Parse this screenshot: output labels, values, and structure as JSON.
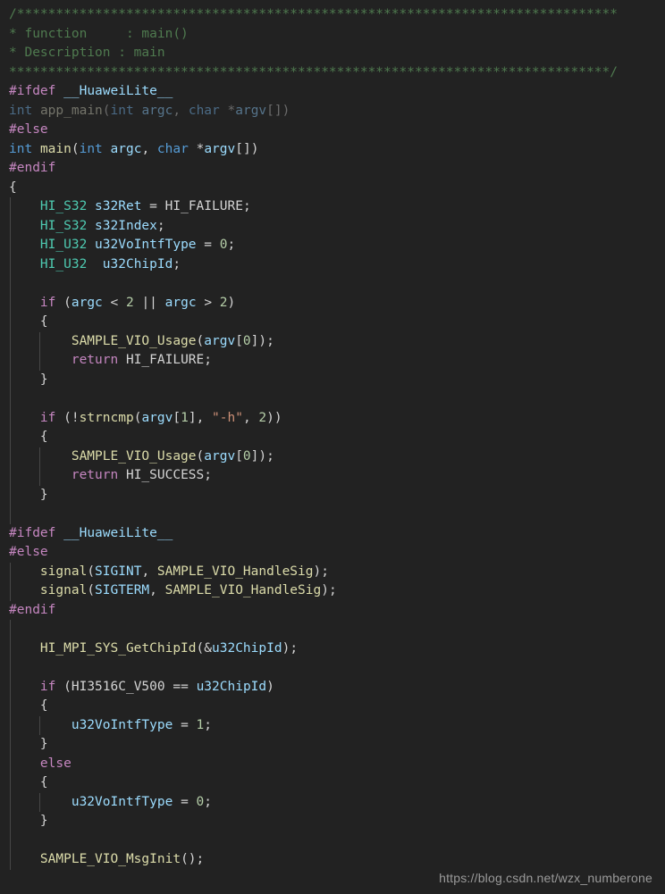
{
  "editor": {
    "background": "#222222",
    "language": "c",
    "font_size_px": 14.5,
    "line_height_px": 21.5
  },
  "theme": {
    "comment": "#4f7a4f",
    "preprocessor": "#c586c0",
    "keyword": "#569cd6",
    "type": "#4ec9b0",
    "function": "#dcdcaa",
    "variable": "#9cdcfe",
    "number": "#b5cea8",
    "string": "#ce9178",
    "default_text": "#d4d4d4",
    "indent_guide": "#474747"
  },
  "watermark": {
    "text": "https://blog.csdn.net/wzx_numberone"
  },
  "code": {
    "lines": [
      {
        "n": 1,
        "text": "/*****************************************************************************"
      },
      {
        "n": 2,
        "text": "* function     : main()"
      },
      {
        "n": 3,
        "text": "* Description : main"
      },
      {
        "n": 4,
        "text": "*****************************************************************************/"
      },
      {
        "n": 5,
        "text": "#ifdef __HuaweiLite__"
      },
      {
        "n": 6,
        "text": "int app_main(int argc, char *argv[])"
      },
      {
        "n": 7,
        "text": "#else"
      },
      {
        "n": 8,
        "text": "int main(int argc, char *argv[])"
      },
      {
        "n": 9,
        "text": "#endif"
      },
      {
        "n": 10,
        "text": "{"
      },
      {
        "n": 11,
        "text": "    HI_S32 s32Ret = HI_FAILURE;"
      },
      {
        "n": 12,
        "text": "    HI_S32 s32Index;"
      },
      {
        "n": 13,
        "text": "    HI_U32 u32VoIntfType = 0;"
      },
      {
        "n": 14,
        "text": "    HI_U32  u32ChipId;"
      },
      {
        "n": 15,
        "text": ""
      },
      {
        "n": 16,
        "text": "    if (argc < 2 || argc > 2)"
      },
      {
        "n": 17,
        "text": "    {"
      },
      {
        "n": 18,
        "text": "        SAMPLE_VIO_Usage(argv[0]);"
      },
      {
        "n": 19,
        "text": "        return HI_FAILURE;"
      },
      {
        "n": 20,
        "text": "    }"
      },
      {
        "n": 21,
        "text": ""
      },
      {
        "n": 22,
        "text": "    if (!strncmp(argv[1], \"-h\", 2))"
      },
      {
        "n": 23,
        "text": "    {"
      },
      {
        "n": 24,
        "text": "        SAMPLE_VIO_Usage(argv[0]);"
      },
      {
        "n": 25,
        "text": "        return HI_SUCCESS;"
      },
      {
        "n": 26,
        "text": "    }"
      },
      {
        "n": 27,
        "text": ""
      },
      {
        "n": 28,
        "text": "#ifdef __HuaweiLite__"
      },
      {
        "n": 29,
        "text": "#else"
      },
      {
        "n": 30,
        "text": "    signal(SIGINT, SAMPLE_VIO_HandleSig);"
      },
      {
        "n": 31,
        "text": "    signal(SIGTERM, SAMPLE_VIO_HandleSig);"
      },
      {
        "n": 32,
        "text": "#endif"
      },
      {
        "n": 33,
        "text": ""
      },
      {
        "n": 34,
        "text": "    HI_MPI_SYS_GetChipId(&u32ChipId);"
      },
      {
        "n": 35,
        "text": ""
      },
      {
        "n": 36,
        "text": "    if (HI3516C_V500 == u32ChipId)"
      },
      {
        "n": 37,
        "text": "    {"
      },
      {
        "n": 38,
        "text": "        u32VoIntfType = 1;"
      },
      {
        "n": 39,
        "text": "    }"
      },
      {
        "n": 40,
        "text": "    else"
      },
      {
        "n": 41,
        "text": "    {"
      },
      {
        "n": 42,
        "text": "        u32VoIntfType = 0;"
      },
      {
        "n": 43,
        "text": "    }"
      },
      {
        "n": 44,
        "text": ""
      },
      {
        "n": 45,
        "text": "    SAMPLE_VIO_MsgInit();"
      }
    ]
  }
}
